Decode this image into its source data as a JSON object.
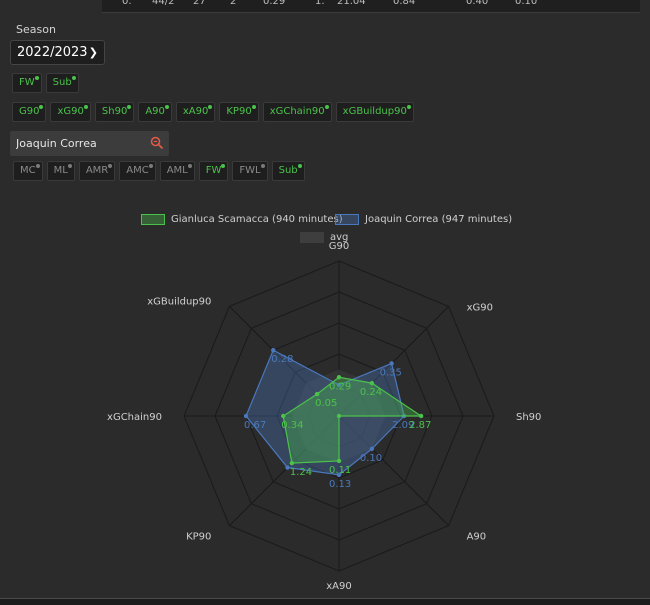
{
  "top_row_values": [
    "0.",
    "44/2",
    "27",
    "2",
    "0.29",
    "1.",
    "21.04",
    "0.84",
    "0.40",
    "0.10"
  ],
  "season": {
    "label": "Season",
    "selected": "2022/2023"
  },
  "position_group_chips": [
    {
      "label": "FW",
      "active": true
    },
    {
      "label": "Sub",
      "active": true
    }
  ],
  "stat_chips": [
    {
      "label": "G90",
      "active": true
    },
    {
      "label": "xG90",
      "active": true
    },
    {
      "label": "Sh90",
      "active": true
    },
    {
      "label": "A90",
      "active": true
    },
    {
      "label": "xA90",
      "active": true
    },
    {
      "label": "KP90",
      "active": true
    },
    {
      "label": "xGChain90",
      "active": true
    },
    {
      "label": "xGBuildup90",
      "active": true
    }
  ],
  "search": {
    "value": "Joaquin Correa",
    "placeholder": ""
  },
  "position_chips": [
    {
      "label": "MC",
      "active": false
    },
    {
      "label": "ML",
      "active": false
    },
    {
      "label": "AMR",
      "active": false
    },
    {
      "label": "AMC",
      "active": false
    },
    {
      "label": "AML",
      "active": false
    },
    {
      "label": "FW",
      "active": true
    },
    {
      "label": "FWL",
      "active": false
    },
    {
      "label": "Sub",
      "active": true
    }
  ],
  "colors": {
    "green": "#4bc24b",
    "blue": "#4a78bd",
    "grid": "#555555"
  },
  "chart_data": {
    "type": "radar",
    "axes": [
      "G90",
      "xG90",
      "Sh90",
      "A90",
      "xA90",
      "KP90",
      "xGChain90",
      "xGBuildup90"
    ],
    "series": [
      {
        "name": "Gianluca Scamacca (940 minutes)",
        "color": "#4bc24b",
        "values": [
          0.29,
          0.24,
          2.87,
          0.0,
          0.11,
          1.24,
          0.34,
          0.05
        ],
        "labels": [
          "0.29",
          "0.24",
          "2.87",
          "",
          "0.11",
          "1.24",
          "0.34",
          "0.05"
        ],
        "norm": [
          0.25,
          0.3,
          0.53,
          0.0,
          0.29,
          0.43,
          0.36,
          0.2
        ]
      },
      {
        "name": "Joaquin Correa (947 minutes)",
        "color": "#4a78bd",
        "values": [
          0.19,
          0.35,
          2.09,
          0.1,
          0.13,
          1.24,
          0.67,
          0.28
        ],
        "labels": [
          "",
          "0.35",
          "2.09",
          "0.10",
          "0.13",
          "",
          "0.67",
          "0.28"
        ],
        "norm": [
          0.2,
          0.48,
          0.42,
          0.3,
          0.38,
          0.47,
          0.6,
          0.6
        ]
      },
      {
        "name": "avg",
        "color": "#444444",
        "values": [],
        "labels": [],
        "norm": [
          0.3,
          0.3,
          0.3,
          0.3,
          0.3,
          0.3,
          0.3,
          0.3
        ]
      }
    ],
    "rings": 5
  }
}
